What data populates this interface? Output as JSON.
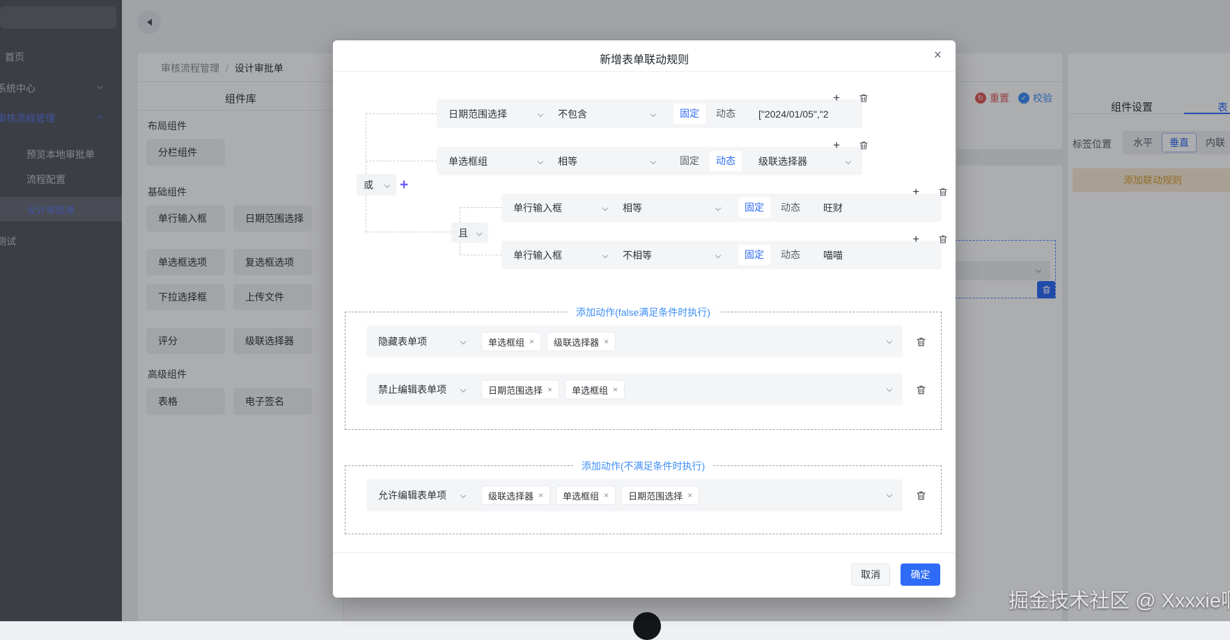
{
  "ui": {
    "plus": "+",
    "close": "×",
    "tag_close": "×",
    "reset_glyph": "↻",
    "validate_glyph": "✓"
  },
  "sidebar": {
    "items": [
      {
        "label": "首页"
      },
      {
        "label": "系统中心"
      },
      {
        "label": "审核流程管理"
      },
      {
        "label": "预览本地审批单"
      },
      {
        "label": "流程配置"
      },
      {
        "label": "设计审批单"
      },
      {
        "label": "测试"
      }
    ]
  },
  "breadcrumb": {
    "parent": "审核流程管理",
    "separator": "/",
    "current": "设计审批单"
  },
  "library": {
    "title": "组件库",
    "groups": [
      {
        "title": "布局组件",
        "items": [
          "分栏组件"
        ]
      },
      {
        "title": "基础组件",
        "items": [
          "单行输入框",
          "日期范围选择",
          "单选框选项",
          "复选框选项",
          "下拉选择框",
          "上传文件",
          "评分",
          "级联选择器"
        ]
      },
      {
        "title": "高级组件",
        "items": [
          "表格",
          "电子签名"
        ]
      }
    ]
  },
  "canvas": {
    "reset_label": "重置",
    "validate_label": "校验"
  },
  "inspector": {
    "tabs": [
      {
        "label": "组件设置"
      },
      {
        "label": "表"
      }
    ],
    "label_position": "标签位置",
    "options": [
      "水平",
      "垂直",
      "内联"
    ],
    "selected_option": "垂直",
    "add_rule_label": "添加联动规则"
  },
  "modal": {
    "title": "新增表单联动规则",
    "logic": {
      "or": "或",
      "and": "且"
    },
    "toggle": {
      "fixed": "固定",
      "dynamic": "动态"
    },
    "conditions": [
      {
        "field": "日期范围选择",
        "operator": "不包含",
        "mode": "fixed",
        "value": "[\"2024/01/05\",\"2"
      },
      {
        "field": "单选框组",
        "operator": "相等",
        "mode": "dynamic",
        "value": "级联选择器"
      },
      {
        "field": "单行输入框",
        "operator": "相等",
        "mode": "fixed",
        "value": "旺财"
      },
      {
        "field": "单行输入框",
        "operator": "不相等",
        "mode": "fixed",
        "value": "喵喵"
      }
    ],
    "actions_false": {
      "title": "添加动作(false满足条件时执行)",
      "rows": [
        {
          "action": "隐藏表单项",
          "tags": [
            "单选框组",
            "级联选择器"
          ]
        },
        {
          "action": "禁止编辑表单项",
          "tags": [
            "日期范围选择",
            "单选框组"
          ]
        }
      ]
    },
    "actions_unmet": {
      "title": "添加动作(不满足条件时执行)",
      "rows": [
        {
          "action": "允许编辑表单项",
          "tags": [
            "级联选择器",
            "单选框组",
            "日期范围选择"
          ]
        }
      ]
    },
    "cancel_label": "取消",
    "confirm_label": "确定"
  },
  "watermark": "掘金技术社区 @ Xxxxie啊",
  "colors": {
    "primary": "#2e6bf6",
    "link_blue": "#3e8ef7",
    "purple": "#6a5af9",
    "red": "#e05b5b",
    "orange": "#d79b2d"
  }
}
